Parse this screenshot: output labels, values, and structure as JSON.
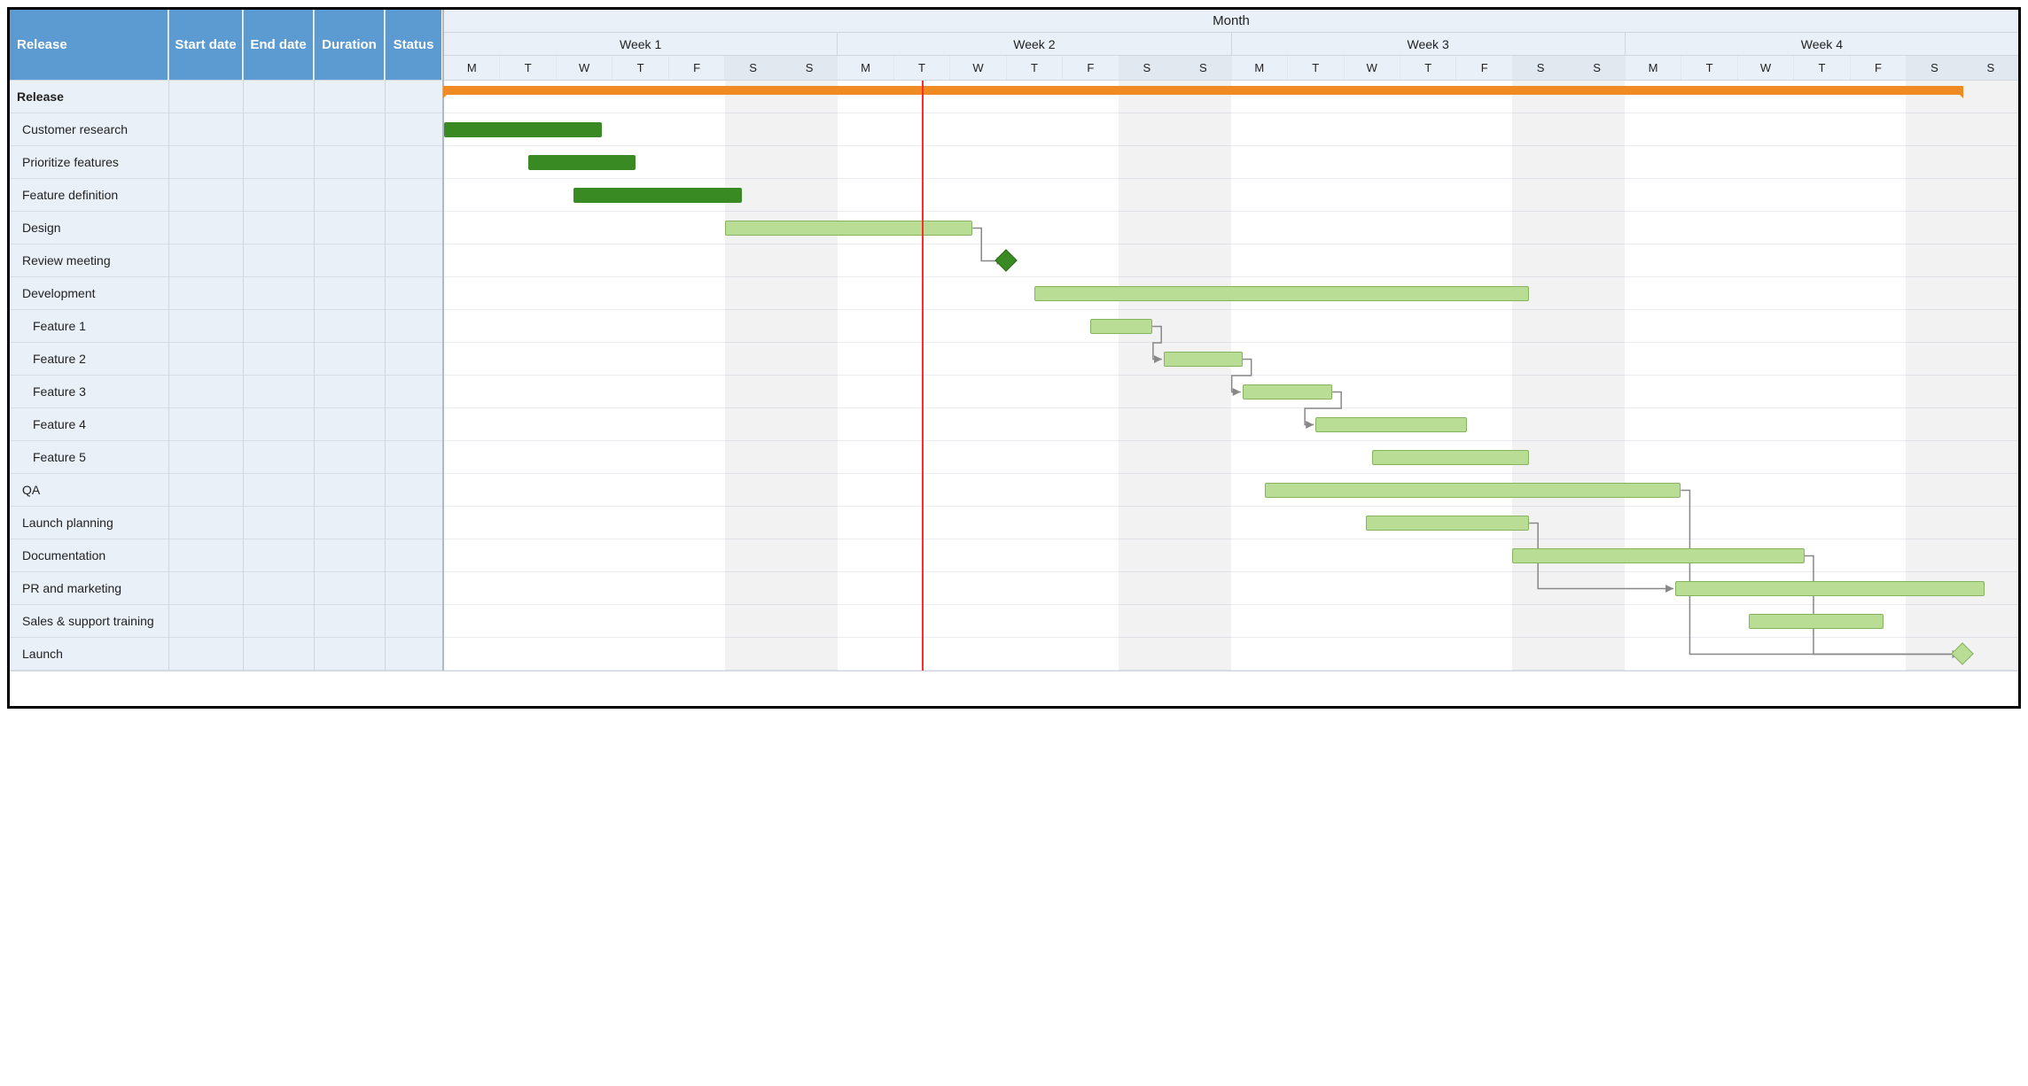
{
  "chart_data": {
    "type": "gantt",
    "title": "Month",
    "time_axis": {
      "unit": "day",
      "total_days": 28,
      "weeks": [
        "Week 1",
        "Week 2",
        "Week 3",
        "Week 4"
      ],
      "day_labels": [
        "M",
        "T",
        "W",
        "T",
        "F",
        "S",
        "S"
      ],
      "today_day_index": 8
    },
    "columns": {
      "task": "Release",
      "start": "Start date",
      "end": "End date",
      "duration": "Duration",
      "status": "Status"
    },
    "tasks": [
      {
        "id": "release",
        "name": "Release",
        "indent": 0,
        "bold": true,
        "type": "summary",
        "start": 0,
        "end": 27
      },
      {
        "id": "cust",
        "name": "Customer research",
        "indent": 1,
        "type": "bar",
        "status": "done",
        "start": 0,
        "end": 2.8
      },
      {
        "id": "prio",
        "name": "Prioritize features",
        "indent": 1,
        "type": "bar",
        "status": "done",
        "start": 1.5,
        "end": 3.4
      },
      {
        "id": "fdef",
        "name": "Feature definition",
        "indent": 1,
        "type": "bar",
        "status": "done",
        "start": 2.3,
        "end": 5.3
      },
      {
        "id": "design",
        "name": "Design",
        "indent": 1,
        "type": "bar",
        "status": "planned",
        "start": 5,
        "end": 9.4
      },
      {
        "id": "review",
        "name": "Review meeting",
        "indent": 1,
        "type": "milestone",
        "status": "done",
        "at": 10
      },
      {
        "id": "dev",
        "name": "Development",
        "indent": 1,
        "type": "bar",
        "status": "planned",
        "start": 10.5,
        "end": 19.3
      },
      {
        "id": "f1",
        "name": "Feature 1",
        "indent": 2,
        "type": "bar",
        "status": "planned",
        "start": 11.5,
        "end": 12.6
      },
      {
        "id": "f2",
        "name": "Feature 2",
        "indent": 2,
        "type": "bar",
        "status": "planned",
        "start": 12.8,
        "end": 14.2
      },
      {
        "id": "f3",
        "name": "Feature 3",
        "indent": 2,
        "type": "bar",
        "status": "planned",
        "start": 14.2,
        "end": 15.8
      },
      {
        "id": "f4",
        "name": "Feature 4",
        "indent": 2,
        "type": "bar",
        "status": "planned",
        "start": 15.5,
        "end": 18.2
      },
      {
        "id": "f5",
        "name": "Feature 5",
        "indent": 2,
        "type": "bar",
        "status": "planned",
        "start": 16.5,
        "end": 19.3
      },
      {
        "id": "qa",
        "name": "QA",
        "indent": 1,
        "type": "bar",
        "status": "planned",
        "start": 14.6,
        "end": 22
      },
      {
        "id": "lplan",
        "name": "Launch planning",
        "indent": 1,
        "type": "bar",
        "status": "planned",
        "start": 16.4,
        "end": 19.3
      },
      {
        "id": "docs",
        "name": "Documentation",
        "indent": 1,
        "type": "bar",
        "status": "planned",
        "start": 19,
        "end": 24.2
      },
      {
        "id": "pr",
        "name": "PR and  marketing",
        "indent": 1,
        "type": "bar",
        "status": "planned",
        "start": 21.9,
        "end": 27.4
      },
      {
        "id": "sales",
        "name": "Sales & support training",
        "indent": 1,
        "type": "bar",
        "status": "planned",
        "start": 23.2,
        "end": 25.6
      },
      {
        "id": "launch",
        "name": "Launch",
        "indent": 1,
        "type": "milestone",
        "status": "planned",
        "at": 27
      }
    ],
    "dependencies": [
      {
        "from": "design",
        "to": "review"
      },
      {
        "from": "f1",
        "to": "f2"
      },
      {
        "from": "f2",
        "to": "f3"
      },
      {
        "from": "f3",
        "to": "f4"
      },
      {
        "from": "qa",
        "to": "launch"
      },
      {
        "from": "lplan",
        "to": "pr"
      },
      {
        "from": "docs",
        "to": "launch"
      }
    ]
  }
}
